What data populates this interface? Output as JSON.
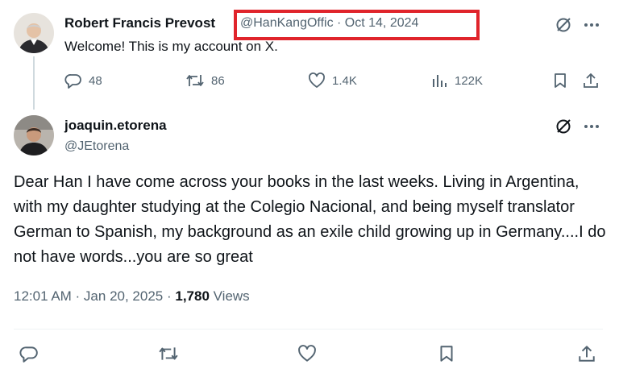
{
  "parent_tweet": {
    "author_name": "Robert Francis Prevost",
    "handle": "@HanKangOffic",
    "separator": "·",
    "date": "Oct 14, 2024",
    "text": "Welcome! This is my account on X.",
    "stats": {
      "replies": "48",
      "reposts": "86",
      "likes": "1.4K",
      "views": "122K"
    }
  },
  "reply_tweet": {
    "author_name": "joaquin.etorena",
    "handle": "@JEtorena",
    "text": "Dear Han I have come across your books in the last weeks. Living in Argentina, with my daughter studying at the Colegio Nacional, and being myself translator German to Spanish, my background as an exile child growing up in Germany....I do not have words...you are so great",
    "timestamp": "12:01 AM · Jan 20, 2025 · ",
    "views_count": "1,780",
    "views_label": " Views"
  },
  "icons": {
    "grok": "grok-icon",
    "more": "more-icon",
    "reply": "reply-icon",
    "repost": "repost-icon",
    "like": "like-icon",
    "views": "views-icon",
    "bookmark": "bookmark-icon",
    "share": "share-icon"
  },
  "colors": {
    "highlight_border": "#e0242b",
    "muted_text": "#536471",
    "primary_text": "#0f1419"
  }
}
